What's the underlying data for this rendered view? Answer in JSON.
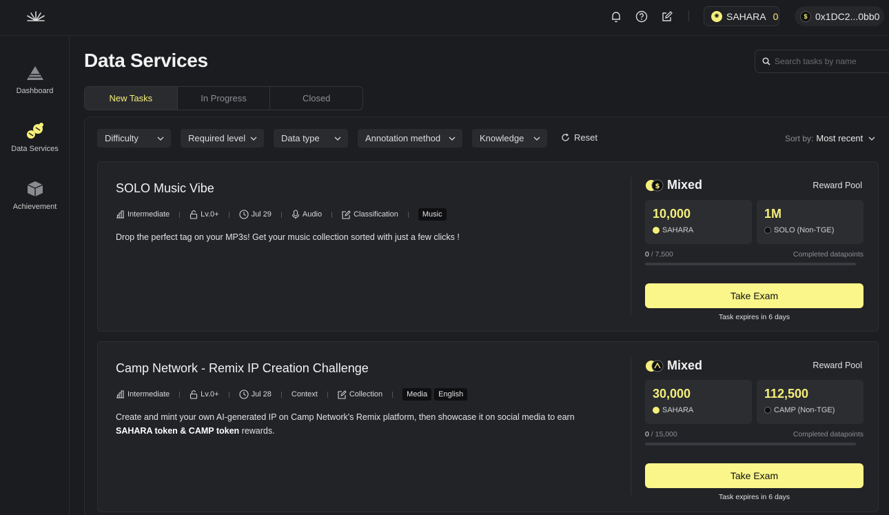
{
  "header": {
    "sahara_label": "SAHARA",
    "sahara_count": "0",
    "wallet_address": "0x1DC2...0bb0"
  },
  "sidebar": {
    "items": [
      {
        "label": "Dashboard",
        "icon": "pyramid-icon"
      },
      {
        "label": "Data Services",
        "icon": "data-services-icon"
      },
      {
        "label": "Achievement",
        "icon": "box-icon"
      }
    ]
  },
  "page": {
    "title": "Data Services",
    "search_placeholder": "Search tasks by name"
  },
  "tabs": [
    {
      "label": "New Tasks",
      "active": true
    },
    {
      "label": "In Progress",
      "active": false
    },
    {
      "label": "Closed",
      "active": false
    }
  ],
  "filters": [
    {
      "label": "Difficulty"
    },
    {
      "label": "Required level"
    },
    {
      "label": "Data type"
    },
    {
      "label": "Annotation method"
    },
    {
      "label": "Knowledge"
    }
  ],
  "reset_label": "Reset",
  "sort": {
    "label": "Sort by:",
    "value": "Most recent"
  },
  "tasks": [
    {
      "title": "SOLO Music Vibe",
      "difficulty": "Intermediate",
      "level": "Lv.0+",
      "date": "Jul 29",
      "data_type": "Audio",
      "method": "Classification",
      "tags": [
        "Music"
      ],
      "description": "Drop the perfect tag on your MP3s! Get your music collection sorted with just a few clicks !",
      "reward_type": "Mixed",
      "reward_pool_label": "Reward Pool",
      "rewards": [
        {
          "amount": "10,000",
          "token": "SAHARA"
        },
        {
          "amount": "1M",
          "token": "SOLO (Non-TGE)"
        }
      ],
      "progress_done": "0",
      "progress_total": "/ 7,500",
      "progress_fraction": 0,
      "progress_label": "Completed datapoints",
      "button_label": "Take Exam",
      "expires": "Task expires in 6 days"
    },
    {
      "title": "Camp Network - Remix IP Creation Challenge",
      "difficulty": "Intermediate",
      "level": "Lv.0+",
      "date": "Jul 28",
      "data_type": "Context",
      "method": "Collection",
      "tags": [
        "Media",
        "English"
      ],
      "description_pre": "Create and mint your own AI-generated IP on Camp Network's Remix platform, then showcase it on social media to earn",
      "description_bold": "SAHARA token & CAMP token",
      "description_post": " rewards.",
      "reward_type": "Mixed",
      "reward_pool_label": "Reward Pool",
      "rewards": [
        {
          "amount": "30,000",
          "token": "SAHARA"
        },
        {
          "amount": "112,500",
          "token": "CAMP (Non-TGE)"
        }
      ],
      "progress_done": "0",
      "progress_total": "/ 15,000",
      "progress_fraction": 0,
      "progress_label": "Completed datapoints",
      "button_label": "Take Exam",
      "expires": "Task expires in 6 days"
    }
  ],
  "colors": {
    "accent": "#f5ef7a",
    "button": "#faf68a",
    "background": "#1b1c1f"
  }
}
